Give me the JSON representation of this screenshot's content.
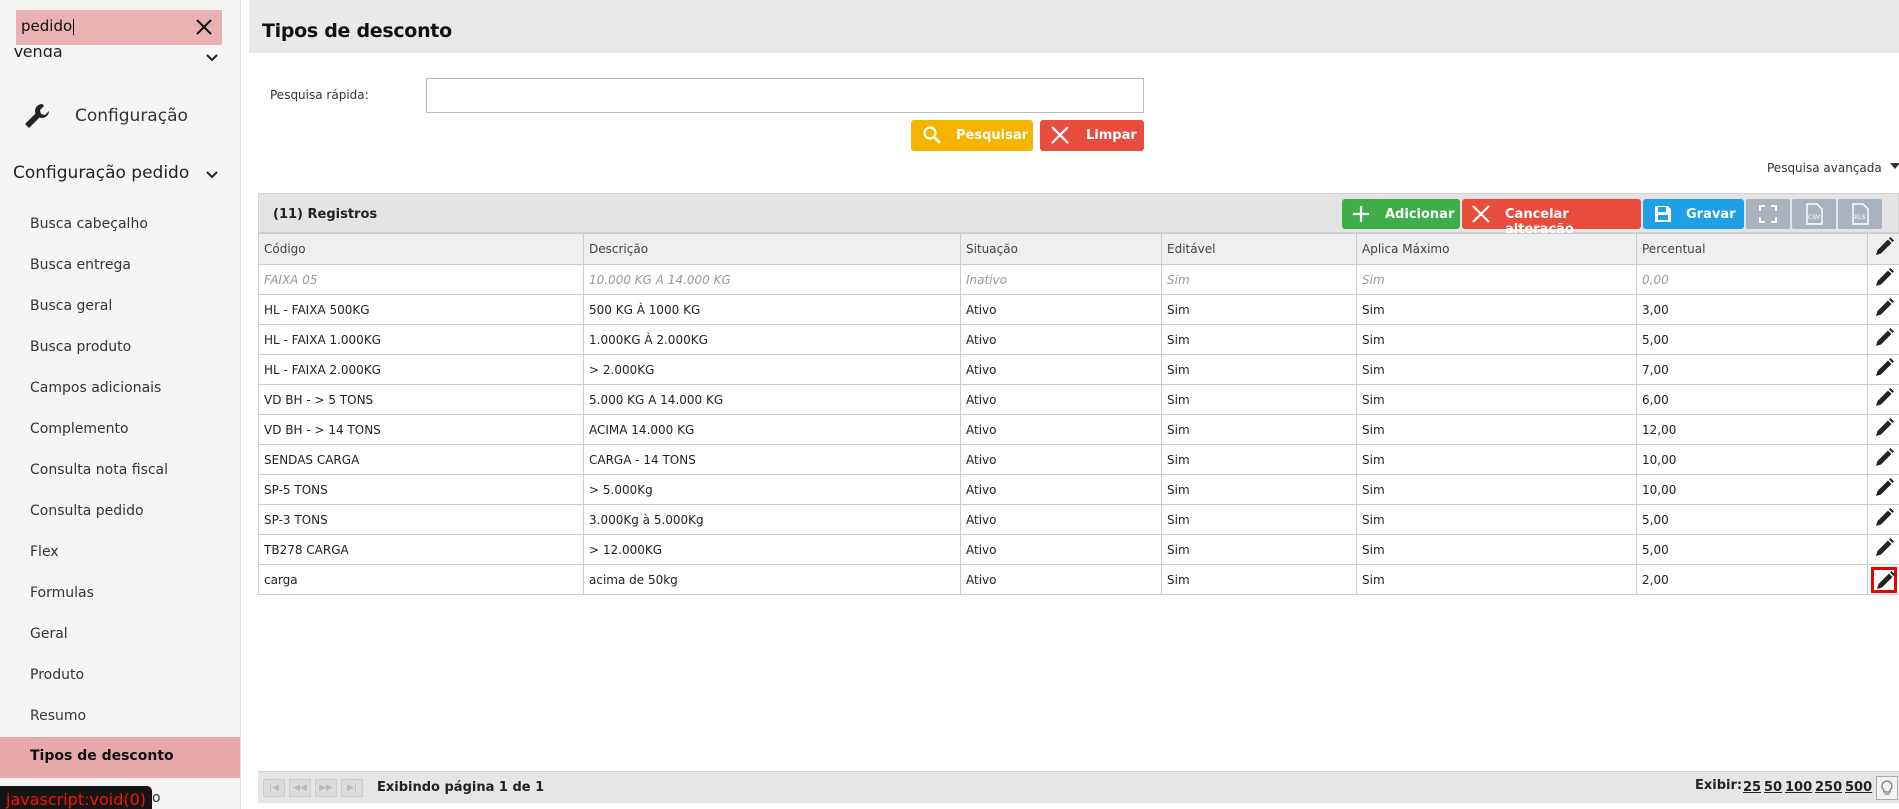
{
  "sidebar": {
    "search_value": "pedido",
    "venda_label": "Venda",
    "config_label": "Configuração",
    "config_pedido_label": "Configuração pedido",
    "items": [
      {
        "label": "Busca cabeçalho"
      },
      {
        "label": "Busca entrega"
      },
      {
        "label": "Busca geral"
      },
      {
        "label": "Busca produto"
      },
      {
        "label": "Campos adicionais"
      },
      {
        "label": "Complemento"
      },
      {
        "label": "Consulta nota fiscal"
      },
      {
        "label": "Consulta pedido"
      },
      {
        "label": "Flex"
      },
      {
        "label": "Formulas"
      },
      {
        "label": "Geral"
      },
      {
        "label": "Produto"
      },
      {
        "label": "Resumo"
      },
      {
        "label": "Tipos de desconto"
      }
    ],
    "active_item": "Tipos de desconto",
    "tooltip": "javascript:void(0)",
    "last_item_partial": "o"
  },
  "main": {
    "title": "Tipos de desconto",
    "quick_search_label": "Pesquisa rápida:",
    "quick_search_value": "",
    "search_button": "Pesquisar",
    "clear_button": "Limpar",
    "advanced_search": "Pesquisa avançada"
  },
  "grid": {
    "records_label": "(11) Registros",
    "add_button": "Adicionar",
    "cancel_button": "Cancelar alteração",
    "save_button": "Gravar",
    "columns": [
      "Código",
      "Descrição",
      "Situação",
      "Editável",
      "Aplica Máximo",
      "Percentual"
    ],
    "rows": [
      [
        "FAIXA 05",
        "10.000 KG A 14.000 KG",
        "Inativo",
        "Sim",
        "Sim",
        "0,00"
      ],
      [
        "HL - FAIXA 500KG",
        "500 KG À 1000 KG",
        "Ativo",
        "Sim",
        "Sim",
        "3,00"
      ],
      [
        "HL - FAIXA 1.000KG",
        "1.000KG À 2.000KG",
        "Ativo",
        "Sim",
        "Sim",
        "5,00"
      ],
      [
        "HL - FAIXA 2.000KG",
        "> 2.000KG",
        "Ativo",
        "Sim",
        "Sim",
        "7,00"
      ],
      [
        "VD BH - > 5 TONS",
        "5.000 KG A 14.000 KG",
        "Ativo",
        "Sim",
        "Sim",
        "6,00"
      ],
      [
        "VD BH - > 14 TONS",
        "ACIMA 14.000 KG",
        "Ativo",
        "Sim",
        "Sim",
        "12,00"
      ],
      [
        "SENDAS CARGA",
        "CARGA - 14 TONS",
        "Ativo",
        "Sim",
        "Sim",
        "10,00"
      ],
      [
        "SP-5 TONS",
        "> 5.000Kg",
        "Ativo",
        "Sim",
        "Sim",
        "10,00"
      ],
      [
        "SP-3 TONS",
        "3.000Kg à 5.000Kg",
        "Ativo",
        "Sim",
        "Sim",
        "5,00"
      ],
      [
        "TB278 CARGA",
        "> 12.000KG",
        "Ativo",
        "Sim",
        "Sim",
        "5,00"
      ],
      [
        "carga",
        "acima de 50kg",
        "Ativo",
        "Sim",
        "Sim",
        "2,00"
      ]
    ]
  },
  "footer": {
    "page_info": "Exibindo página 1 de 1",
    "show_label": "Exibir:",
    "page_sizes": [
      "25",
      "50",
      "100",
      "250",
      "500"
    ]
  },
  "colors": {
    "accent_active": "#e6a8a8",
    "search_btn": "#f5b400",
    "danger": "#e74c3c",
    "success": "#3fae4a",
    "save": "#1e9fe6"
  }
}
